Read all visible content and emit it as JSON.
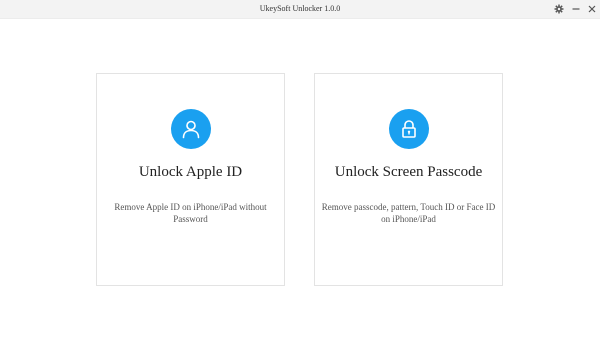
{
  "window": {
    "title": "UkeySoft Unlocker 1.0.0",
    "controls": [
      "gear-icon",
      "minimize-icon",
      "close-icon"
    ]
  },
  "colors": {
    "accent": "#1aa0f0",
    "card_border": "#e3e3e3",
    "titlebar_bg": "#f3f3f3"
  },
  "cards": [
    {
      "icon": "user-icon",
      "title": "Unlock Apple ID",
      "description": "Remove Apple ID on iPhone/iPad without Password"
    },
    {
      "icon": "lock-icon",
      "title": "Unlock Screen Passcode",
      "description": "Remove passcode, pattern, Touch ID or Face ID on iPhone/iPad"
    }
  ]
}
